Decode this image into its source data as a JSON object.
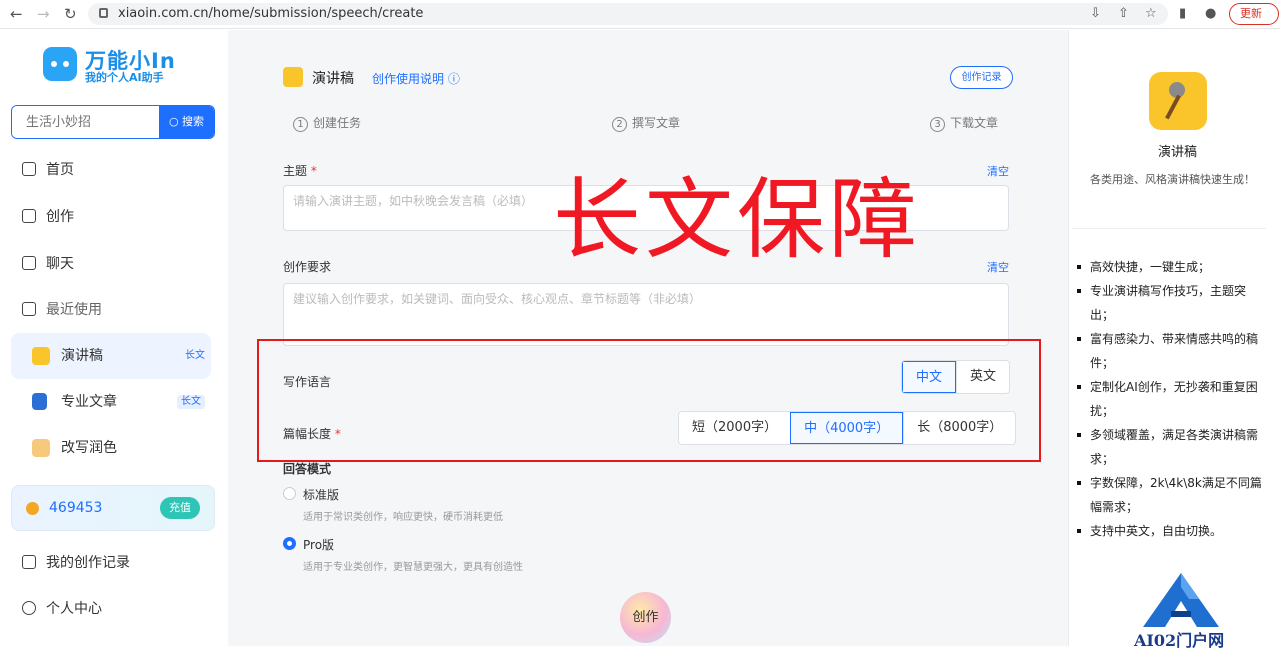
{
  "browser": {
    "url": "xiaoin.com.cn/home/submission/speech/create",
    "refresh_label": "更新"
  },
  "sidebar": {
    "logo_title": "万能小In",
    "logo_sub": "我的个人AI助手",
    "search_placeholder": "生活小妙招",
    "search_button": "搜索",
    "nav": [
      {
        "label": "首页",
        "icon": "home-icon"
      },
      {
        "label": "创作",
        "icon": "edit-icon"
      },
      {
        "label": "聊天",
        "icon": "chat-icon"
      },
      {
        "label": "最近使用",
        "icon": "recent-icon"
      }
    ],
    "recent": [
      {
        "label": "演讲稿",
        "tag": "长文"
      },
      {
        "label": "专业文章",
        "tag": "长文"
      },
      {
        "label": "改写润色",
        "tag": ""
      }
    ],
    "coins": "469453",
    "charge_label": "充值",
    "bottom_nav": [
      {
        "label": "我的创作记录",
        "icon": "record-icon"
      },
      {
        "label": "个人中心",
        "icon": "user-icon"
      }
    ]
  },
  "main": {
    "title": "演讲稿",
    "help_link": "创作使用说明 ⓘ",
    "records_button": "创作记录",
    "steps": [
      {
        "num": "1",
        "label": "创建任务"
      },
      {
        "num": "2",
        "label": "撰写文章"
      },
      {
        "num": "3",
        "label": "下载文章"
      }
    ],
    "topic_label": "主题",
    "required_mark": "*",
    "clear_label": "清空",
    "topic_placeholder": "请输入演讲主题，如中秋晚会发言稿（必填）",
    "req_label": "创作要求",
    "req_placeholder": "建议输入创作要求，如关键词、面向受众、核心观点、章节标题等（非必填）",
    "lang_label": "写作语言",
    "lang_options": [
      "中文",
      "英文"
    ],
    "lang_selected": "中文",
    "length_label": "篇幅长度",
    "length_options": [
      "短（2000字）",
      "中（4000字）",
      "长（8000字）"
    ],
    "length_selected": "中（4000字）",
    "mode_label": "回答模式",
    "modes": [
      {
        "label": "标准版",
        "desc": "适用于常识类创作，响应更快，硬币消耗更低",
        "selected": false
      },
      {
        "label": "Pro版",
        "desc": "适用于专业类创作，更智慧更强大，更具有创造性",
        "selected": true
      }
    ],
    "create_button": "创作",
    "watermark": "长文保障"
  },
  "right": {
    "title": "演讲稿",
    "subtitle": "各类用途、风格演讲稿快速生成！",
    "features": [
      "高效快捷，一键生成；",
      "专业演讲稿写作技巧，主题突出；",
      "富有感染力、带来情感共鸣的稿件；",
      "定制化AI创作，无抄袭和重复困扰；",
      "多领域覆盖，满足各类演讲稿需求；",
      "字数保障，2k\\4k\\8k满足不同篇幅需求；",
      "支持中英文，自由切换。"
    ],
    "brand": "AI02门户网"
  },
  "colors": {
    "accent": "#1f6fff",
    "highlight_box": "#e61a1a",
    "watermark": "#f01823"
  }
}
